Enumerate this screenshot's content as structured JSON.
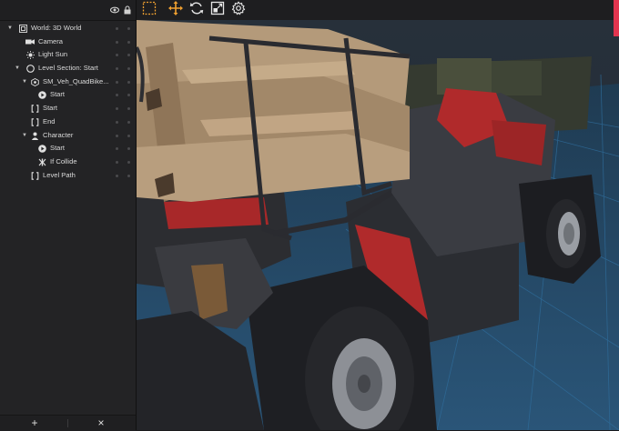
{
  "outliner": {
    "header_icons": [
      "eye-icon",
      "lock-icon"
    ],
    "items": [
      {
        "label": "World: 3D World",
        "icon": "world-icon",
        "expanded": true,
        "depth": 0
      },
      {
        "label": "Camera",
        "icon": "camera-icon",
        "expanded": null,
        "depth": 1
      },
      {
        "label": "Light Sun",
        "icon": "sun-icon",
        "expanded": null,
        "depth": 1
      },
      {
        "label": "Level Section: Start",
        "icon": "level-section-icon",
        "expanded": true,
        "depth": 1
      },
      {
        "label": "SM_Veh_QuadBike...",
        "icon": "mesh-icon",
        "expanded": true,
        "depth": 2
      },
      {
        "label": "Start",
        "icon": "play-icon",
        "expanded": null,
        "depth": 3
      },
      {
        "label": "Start",
        "icon": "bracket-icon",
        "expanded": null,
        "depth": 2
      },
      {
        "label": "End",
        "icon": "bracket-icon",
        "expanded": null,
        "depth": 2
      },
      {
        "label": "Character",
        "icon": "person-icon",
        "expanded": true,
        "depth": 2
      },
      {
        "label": "Start",
        "icon": "play-icon",
        "expanded": null,
        "depth": 3
      },
      {
        "label": "If Collide",
        "icon": "collide-icon",
        "expanded": null,
        "depth": 3
      },
      {
        "label": "Level Path",
        "icon": "path-icon",
        "expanded": null,
        "depth": 2
      }
    ],
    "bottom": {
      "add_label": "+",
      "delete_label": "×"
    }
  },
  "toolbar": {
    "tools": [
      {
        "name": "select-tool",
        "icon": "marquee-select-icon",
        "active": false
      },
      {
        "name": "move-tool",
        "icon": "move-arrows-icon",
        "active": true
      },
      {
        "name": "rotate-tool",
        "icon": "rotate-icon",
        "active": false
      },
      {
        "name": "scale-tool",
        "icon": "scale-icon",
        "active": false
      },
      {
        "name": "settings-tool",
        "icon": "gear-icon",
        "active": false
      }
    ]
  },
  "viewport": {
    "scene": "quad bike 3D model",
    "accent": "#e2354f"
  }
}
